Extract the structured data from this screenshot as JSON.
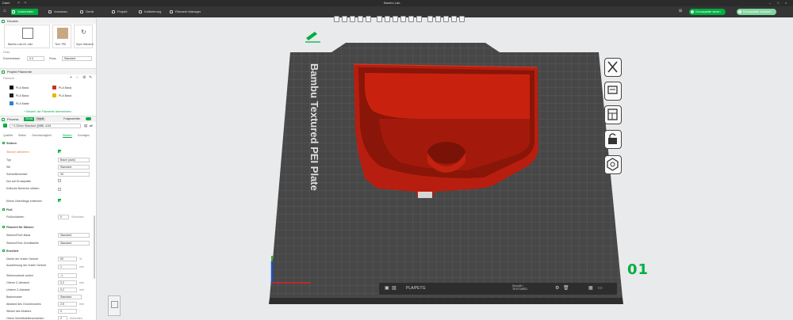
{
  "titlebar": {
    "left_label": "Datei",
    "center_title": "Bambu Lab"
  },
  "tabs": [
    {
      "label": "Vorbereiten",
      "active": true
    },
    {
      "label": "Vorschau"
    },
    {
      "label": "Gerät"
    },
    {
      "label": "Projekt"
    },
    {
      "label": "Kalibrierung"
    },
    {
      "label": "Filament Manager"
    }
  ],
  "actions": {
    "slice_label": "Druckplatte slicen",
    "print_label": "Druckplatte drucken"
  },
  "sidebar": {
    "printer_section": "Drucker",
    "printer_name": "Bambu Lab A1 mini",
    "plate_label": "Text. PEI",
    "sync_label": "Sync filament",
    "nozzle_section": "Düse",
    "diameter_label": "Durchmesser",
    "diameter_value": "0.4",
    "flow_label": "Fluss",
    "flow_value": "Standard",
    "filament_section": "Projekt Filamente",
    "filament_subtitle": "Filament",
    "filaments": [
      {
        "num": "1",
        "color": "#111111",
        "name": "PLA Basic"
      },
      {
        "num": "2",
        "color": "#c0392b",
        "name": "PLA Basic"
      },
      {
        "num": "3",
        "color": "#1f1f1f",
        "name": "PLA Basic"
      },
      {
        "num": "4",
        "color": "#e6b800",
        "name": "PLA Basic"
      },
      {
        "num": "5",
        "color": "#2f7fd0",
        "name": "PLA Matte"
      }
    ],
    "add_filament_label": "+ Einstell. der Filamente übernehmen",
    "process_section": "Prozess",
    "process_toggle_global": "Global",
    "process_toggle_object": "Objekt",
    "process_advanced": "Fortgeschritten",
    "process_profile": "* 0.20mm Standard @BBL A1M",
    "subtabs": [
      "Qualität",
      "Stärke",
      "Geschwindigkeit",
      "Stützen",
      "Sonstiges"
    ],
    "support_header": "Stützen",
    "support_rows": [
      {
        "label": "Stützen aktivieren",
        "type": "check",
        "checked": true,
        "highlight": true
      },
      {
        "label": "Typ",
        "type": "field",
        "value": "Baum (auto)"
      },
      {
        "label": "Stil",
        "type": "field",
        "value": "Standard"
      },
      {
        "label": "Schwellenwinkel",
        "type": "field",
        "value": "30"
      },
      {
        "label": "Nur auf Druckplatte",
        "type": "check",
        "checked": false
      },
      {
        "label": "Kritische Bereiche stützen",
        "type": "check",
        "checked": false
      },
      {
        "label": "Kleine Überhänge entfernen",
        "type": "check",
        "checked": true
      }
    ],
    "raft_header": "Floß",
    "raft_layers_label": "Floßschichten",
    "raft_layers_value": "0",
    "raft_layers_unit": "Schichten",
    "filament_support_header": "Filament für Stützen",
    "support_base_label": "Stützen/Floß-Basis",
    "support_base_value": "Standard",
    "support_iface_label": "Stützen/Floß-Schnittstelle",
    "support_iface_value": "Standard",
    "advanced_header": "Erweitert",
    "advanced_rows": [
      {
        "label": "Dichte der ersten Schicht",
        "value": "90",
        "unit": "%"
      },
      {
        "label": "Ausdehnung der ersten Schicht",
        "value": "1",
        "unit": "mm"
      },
      {
        "label": "Stützenwände außen",
        "value": "-1",
        "unit": ""
      },
      {
        "label": "Oberer Z-Abstand",
        "value": "0.2",
        "unit": "mm"
      },
      {
        "label": "Unterer Z-Abstand",
        "value": "0.2",
        "unit": "mm"
      },
      {
        "label": "Basismuster",
        "value": "Standard",
        "unit": ""
      },
      {
        "label": "Abstand des Grundmusters",
        "value": "2.5",
        "unit": "mm"
      },
      {
        "label": "Winkel des Musters",
        "value": "0",
        "unit": "°"
      },
      {
        "label": "Obere Schnittstellenschichten",
        "value": "2",
        "unit": "Schichten"
      }
    ]
  },
  "viewport": {
    "plate_text": "Bambu Textured PEI Plate",
    "plate_number": "01",
    "plate_filament": "PLA/PETG",
    "plate_side_text": "Smooth / TEXTURED"
  },
  "colors": {
    "accent": "#00ae42",
    "model": "#b81e0f",
    "plate": "#4a4a4a"
  }
}
